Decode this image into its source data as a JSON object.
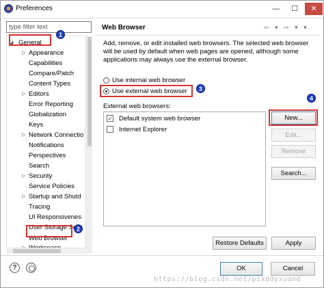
{
  "window": {
    "title": "Preferences",
    "controls": {
      "minimize": "—",
      "maximize": "☐",
      "close": "✕"
    }
  },
  "filter": {
    "placeholder": "type filter text"
  },
  "tree": {
    "items": [
      {
        "label": "General",
        "arrow": "◢"
      },
      {
        "label": "Appearance",
        "arrow": "▷"
      },
      {
        "label": "Capabilities"
      },
      {
        "label": "Compare/Patch"
      },
      {
        "label": "Content Types"
      },
      {
        "label": "Editors",
        "arrow": "▷"
      },
      {
        "label": "Error Reporting"
      },
      {
        "label": "Globalization"
      },
      {
        "label": "Keys"
      },
      {
        "label": "Network Connectio",
        "arrow": "▷"
      },
      {
        "label": "Notifications"
      },
      {
        "label": "Perspectives"
      },
      {
        "label": "Search"
      },
      {
        "label": "Security",
        "arrow": "▷"
      },
      {
        "label": "Service Policies"
      },
      {
        "label": "Startup and Shutd",
        "arrow": "▷"
      },
      {
        "label": "Tracing"
      },
      {
        "label": "UI Responsivenes"
      },
      {
        "label": "User Storage Serv"
      },
      {
        "label": "Web Browser"
      },
      {
        "label": "Workspace",
        "arrow": "▷"
      }
    ]
  },
  "markers": [
    "1",
    "2",
    "3",
    "4"
  ],
  "page": {
    "title": "Web Browser",
    "nav": "⇦ ▾ ⇨ ▾ ▾",
    "description": "Add, remove, or edit installed web browsers. The selected web browser will be used by default when web pages are opened, although some applications may always use the external browser.",
    "radio_internal": "Use internal web browser",
    "radio_external": "Use external web browser",
    "list_label": "External web browsers:",
    "browsers": [
      {
        "name": "Default system web browser",
        "check": "✓"
      },
      {
        "name": "Internet Explorer",
        "check": ""
      }
    ],
    "buttons": {
      "new": "New...",
      "edit": "Edit...",
      "remove": "Remove",
      "search": "Search...",
      "restore": "Restore Defaults",
      "apply": "Apply"
    }
  },
  "footer": {
    "help": "?",
    "ok": "OK",
    "cancel": "Cancel"
  },
  "watermark": "https://blog.csdn.net/pixddyxuand",
  "colors": {
    "highlight": "#d8322e",
    "marker": "#1f3fbf"
  }
}
